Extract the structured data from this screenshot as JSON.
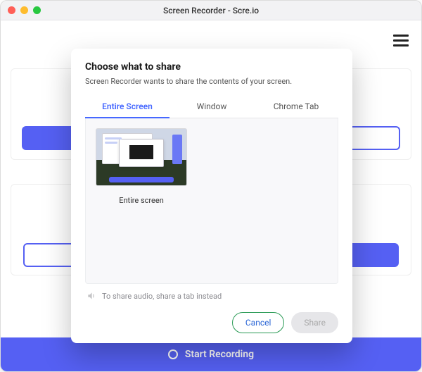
{
  "window": {
    "title": "Screen Recorder - Scre.io"
  },
  "footer": {
    "start_label": "Start Recording"
  },
  "modal": {
    "heading": "Choose what to share",
    "subtext": "Screen Recorder wants to share the contents of your screen.",
    "tabs": {
      "entire_screen": "Entire Screen",
      "window": "Window",
      "chrome_tab": "Chrome Tab",
      "active": "entire_screen"
    },
    "thumbnail": {
      "label": "Entire screen"
    },
    "audio_note": "To share audio, share a tab instead",
    "actions": {
      "cancel": "Cancel",
      "share": "Share",
      "share_enabled": false
    }
  }
}
